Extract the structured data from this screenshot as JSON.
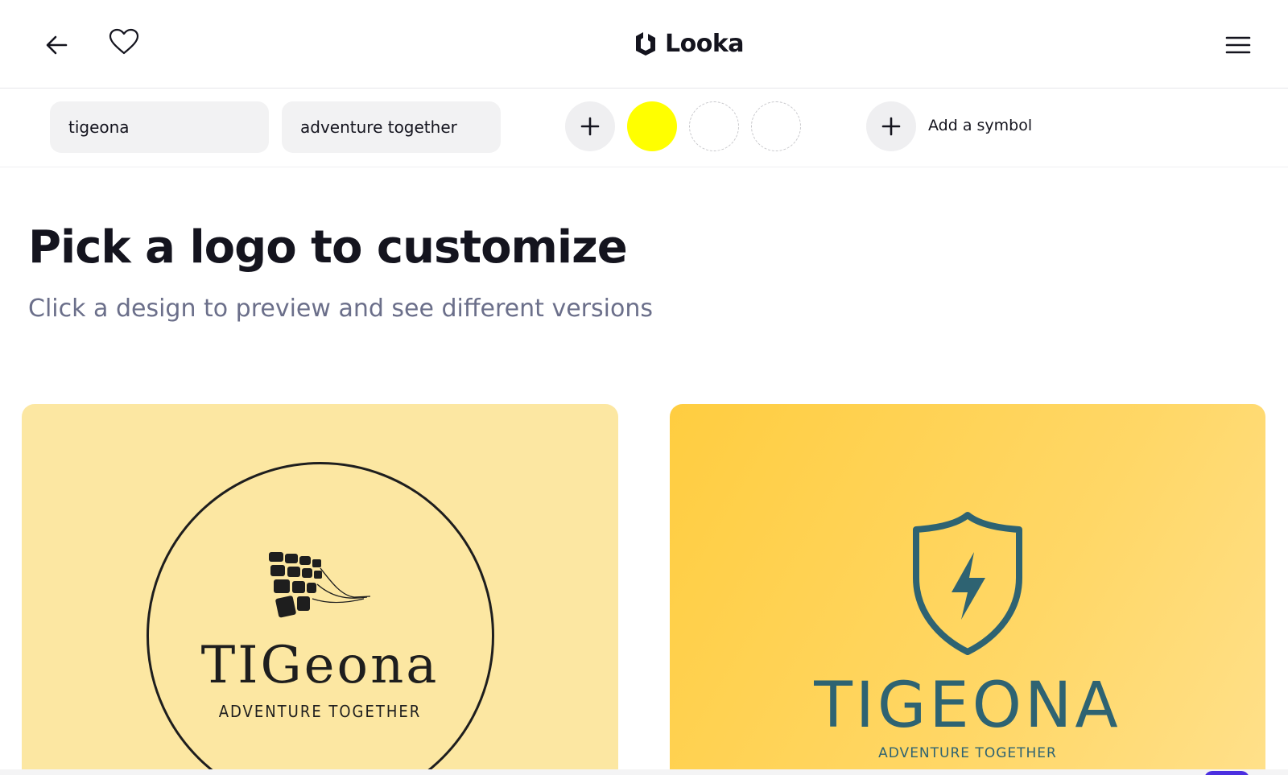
{
  "header": {
    "brand_name": "Looka",
    "back_icon": "arrow-left-icon",
    "favorite_icon": "heart-icon",
    "menu_icon": "hamburger-menu-icon"
  },
  "toolbar": {
    "company_name_value": "tigeona",
    "slogan_value": "adventure together",
    "colors": [
      "#ffff00"
    ],
    "add_symbol_label": "Add a symbol"
  },
  "main": {
    "title": "Pick a logo to customize",
    "subtitle": "Click a design to preview and see different versions"
  },
  "cards": [
    {
      "wordmark": "TIGeona",
      "tagline": "ADVENTURE TOGETHER",
      "background": "#fce7a2",
      "ink": "#1e1e1e"
    },
    {
      "wordmark": "TIGEONA",
      "tagline": "ADVENTURE TOGETHER",
      "background": "#ffcd40",
      "ink": "#2e6372"
    }
  ]
}
